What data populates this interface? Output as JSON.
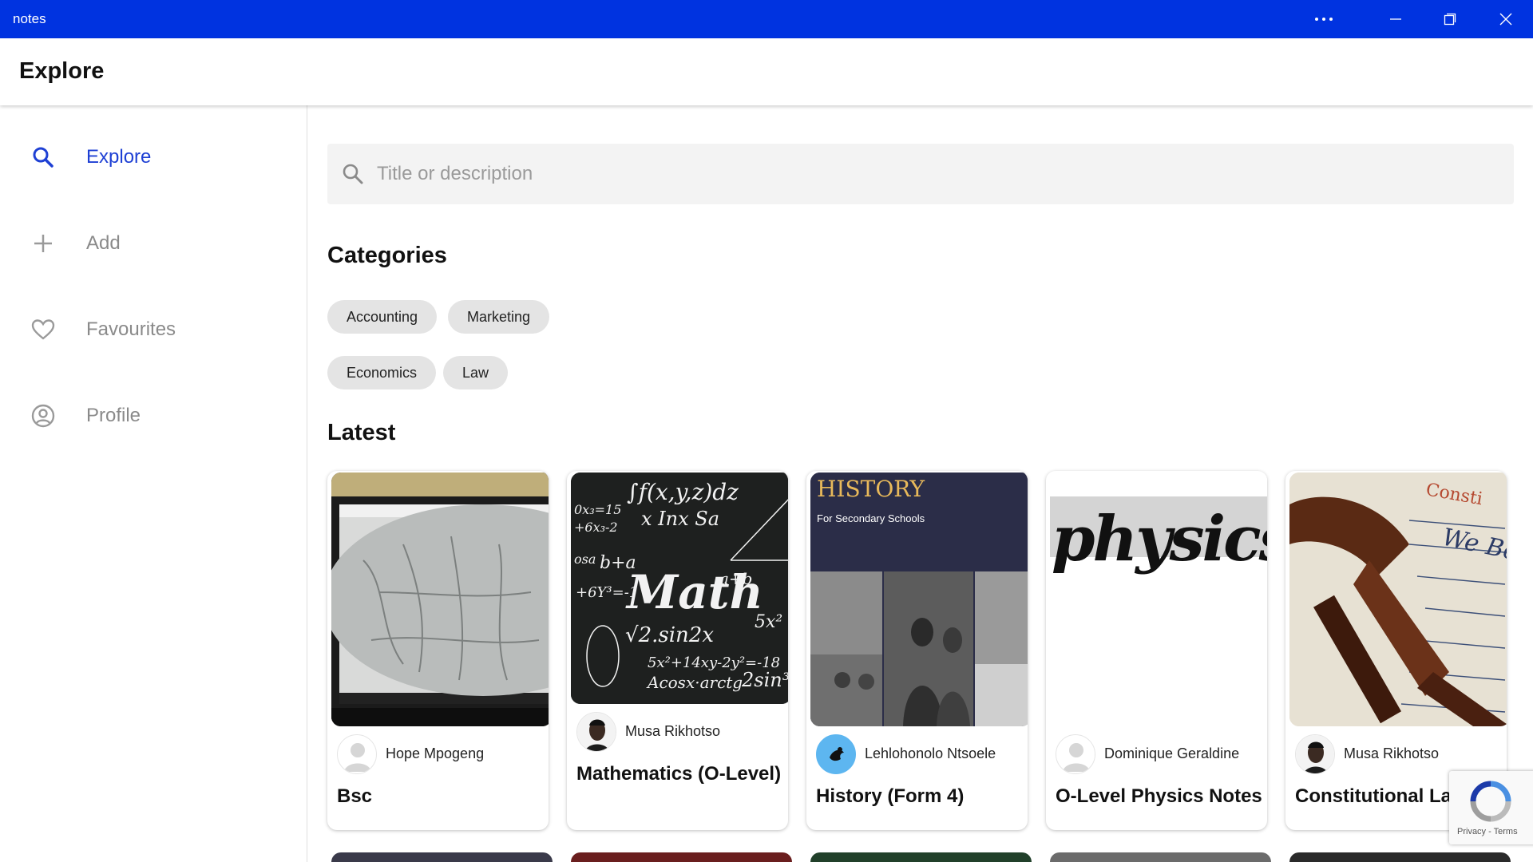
{
  "window": {
    "app_name": "notes",
    "titlebar_color": "#0033e0",
    "buttons": [
      "more-icon",
      "minimize-icon",
      "restore-icon",
      "close-icon"
    ]
  },
  "header": {
    "title": "Explore"
  },
  "sidebar": {
    "accent": "#1e40d4",
    "items": [
      {
        "label": "Explore",
        "icon": "search-icon",
        "active": true
      },
      {
        "label": "Add",
        "icon": "plus-icon",
        "active": false
      },
      {
        "label": "Favourites",
        "icon": "heart-icon",
        "active": false
      },
      {
        "label": "Profile",
        "icon": "user-circle-icon",
        "active": false
      }
    ]
  },
  "search": {
    "placeholder": "Title or description",
    "value": ""
  },
  "categories": {
    "title": "Categories",
    "items": [
      "Accounting",
      "Marketing",
      "Economics",
      "Law"
    ]
  },
  "latest": {
    "title": "Latest",
    "cards": [
      {
        "title": "Bsc",
        "author": "Hope Mpogeng",
        "thumbnail": "microscope-screen-photo",
        "avatar": "default-avatar"
      },
      {
        "title": "Mathematics (O-Level)",
        "author": "Musa Rikhotso",
        "thumbnail": "math-chalkboard",
        "thumbnail_text": "Math",
        "avatar": "portrait-avatar"
      },
      {
        "title": "History (Form 4)",
        "author": "Lehlohonolo Ntsoele",
        "thumbnail": "history-book-cover",
        "thumbnail_heading": "HISTORY",
        "thumbnail_subheading": "For Secondary Schools",
        "avatar": "bird-logo-avatar"
      },
      {
        "title": "O-Level Physics Notes",
        "author": "Dominique Geraldine",
        "thumbnail": "physics-lettering",
        "thumbnail_text": "physics",
        "avatar": "default-avatar"
      },
      {
        "title": "Constitutional Law",
        "author": "Musa Rikhotso",
        "thumbnail": "gavel-constitution-photo",
        "avatar": "portrait-avatar"
      }
    ]
  },
  "recaptcha": {
    "privacy": "Privacy",
    "separator": " - ",
    "terms": "Terms"
  }
}
